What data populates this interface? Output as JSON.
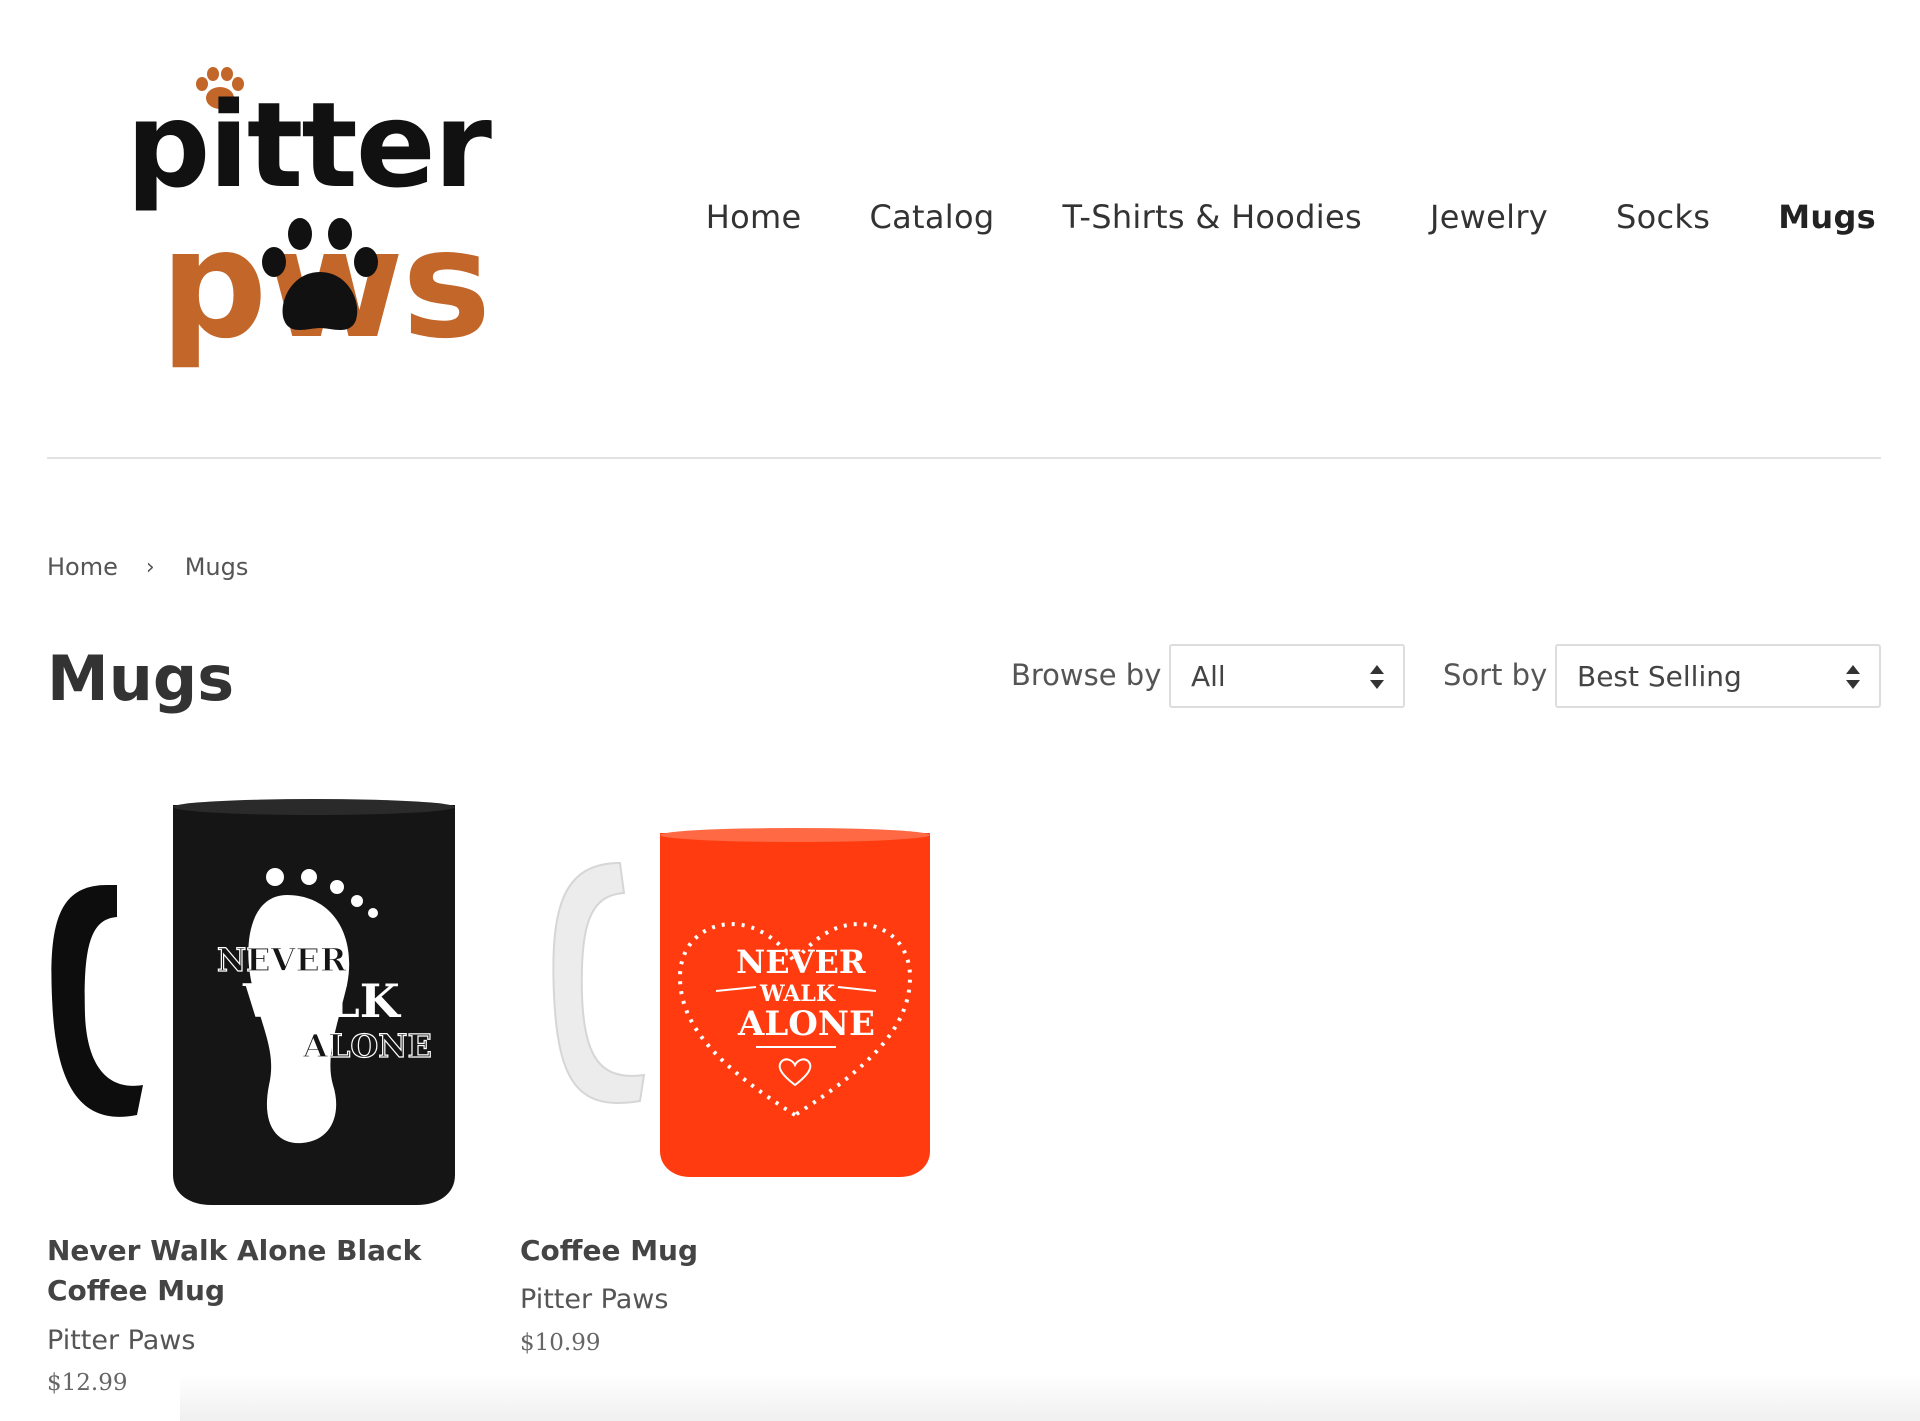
{
  "brand": {
    "logo_line1": "pitter",
    "logo_line2": "pws",
    "colors": {
      "dark": "#111111",
      "orange": "#c2662a"
    }
  },
  "nav": {
    "items": [
      {
        "label": "Home"
      },
      {
        "label": "Catalog"
      },
      {
        "label": "T-Shirts & Hoodies"
      },
      {
        "label": "Jewelry"
      },
      {
        "label": "Socks"
      },
      {
        "label": "Mugs",
        "active": true
      }
    ]
  },
  "breadcrumb": {
    "home": "Home",
    "separator": "›",
    "current": "Mugs"
  },
  "page": {
    "title": "Mugs"
  },
  "filters": {
    "browse_label": "Browse by",
    "browse_value": "All",
    "sort_label": "Sort by",
    "sort_value": "Best Selling"
  },
  "products": [
    {
      "name": "Never Walk Alone Black Coffee Mug",
      "vendor": "Pitter Paws",
      "price": "$12.99",
      "mug_color": "#111111",
      "art_text": [
        "NEVER",
        "WALK",
        "ALONE"
      ]
    },
    {
      "name": "Coffee Mug",
      "vendor": "Pitter Paws",
      "price": "$10.99",
      "mug_color": "#ff3b0f",
      "art_text": [
        "NEVER",
        "WALK",
        "ALONE"
      ]
    }
  ]
}
